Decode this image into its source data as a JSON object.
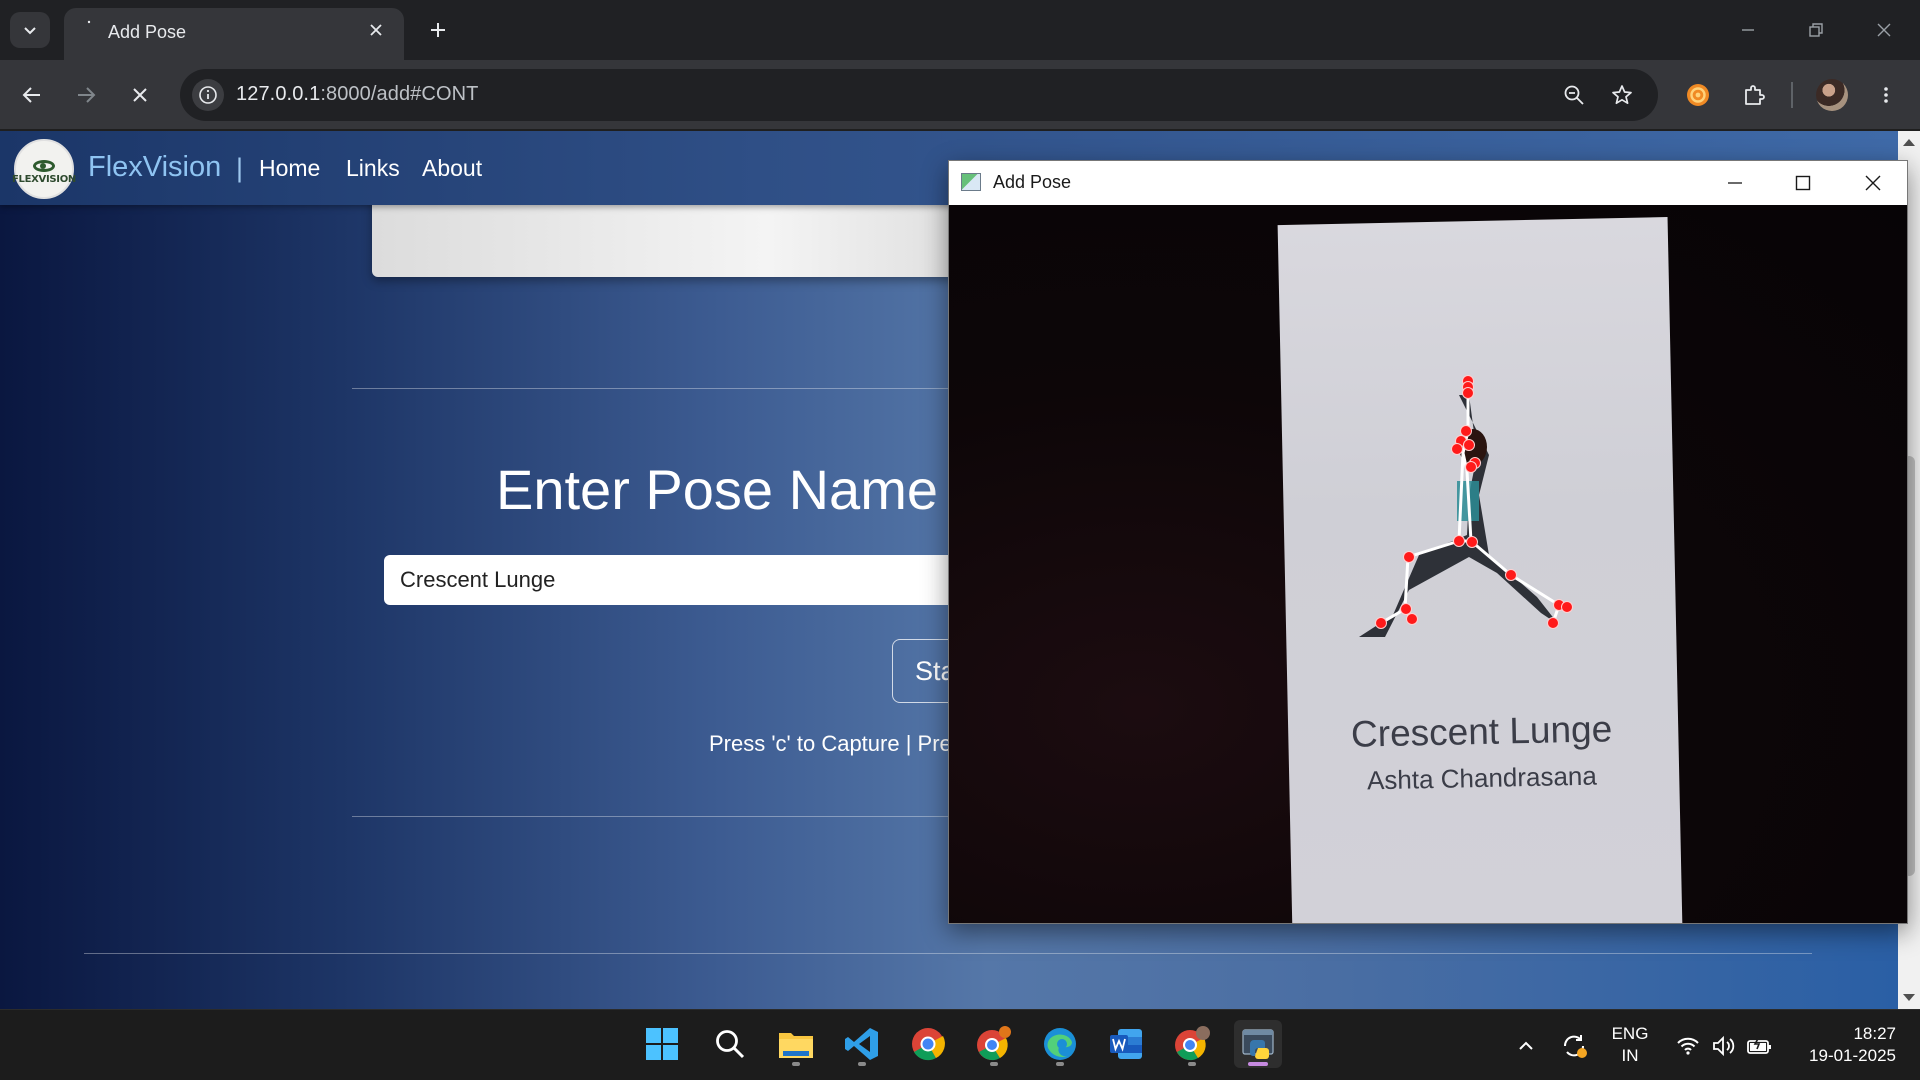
{
  "browser": {
    "tab_title": "Add Pose",
    "url_host": "127.0.0.1",
    "url_path": ":8000/add#CONT"
  },
  "site": {
    "brand": "FlexVision",
    "separator": "|",
    "logo_text": "FLEXVISION",
    "nav": [
      "Home",
      "Links",
      "About"
    ]
  },
  "form": {
    "title": "Enter Pose Name",
    "pose_input_value": "Crescent Lunge",
    "start_button_label": "Start",
    "hint": "Press 'c' to Capture | Press 'q' to Quit"
  },
  "cv_window": {
    "title": "Add Pose",
    "card_title": "Crescent Lunge",
    "card_subtitle": "Ashta Chandrasana"
  },
  "taskbar": {
    "apps": [
      "start",
      "search",
      "file-explorer",
      "vs-code",
      "chrome",
      "chrome-canary",
      "edge",
      "word",
      "chrome-profile",
      "python"
    ],
    "language_line1": "ENG",
    "language_line2": "IN",
    "time": "18:27",
    "date": "19-01-2025"
  },
  "colors": {
    "accent_brand": "#8fc4f2",
    "keypoint": "#ff1a1a",
    "active_indicator": "#c68ae0"
  }
}
